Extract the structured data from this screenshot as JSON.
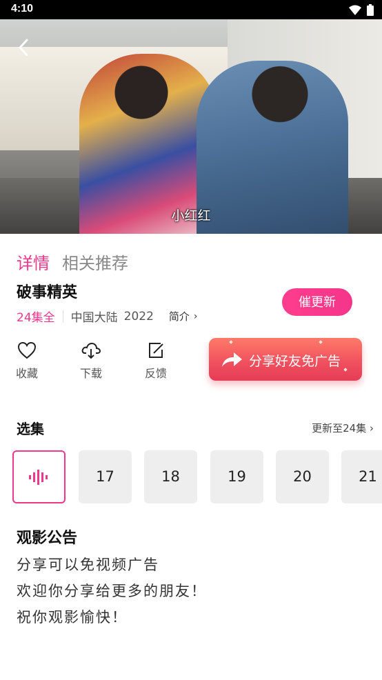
{
  "status_bar": {
    "time": "4:10"
  },
  "video": {
    "subtitle": "小红红"
  },
  "tabs": [
    {
      "label": "详情"
    },
    {
      "label": "相关推荐"
    }
  ],
  "show": {
    "title": "破事精英",
    "episodes_total": "24集全",
    "region": "中国大陆",
    "year": "2022",
    "intro_label": "简介"
  },
  "urge_button": {
    "label": "催更新"
  },
  "actions": [
    {
      "label": "收藏",
      "icon": "heart-icon"
    },
    {
      "label": "下载",
      "icon": "download-icon"
    },
    {
      "label": "反馈",
      "icon": "feedback-icon"
    }
  ],
  "share_banner": {
    "label": "分享好友免广告",
    "icon": "share-arrow-icon"
  },
  "episodes_section": {
    "title": "选集",
    "update_info": "更新至24集",
    "items": [
      "17",
      "18",
      "19",
      "20",
      "21"
    ]
  },
  "notice": {
    "title": "观影公告",
    "lines": [
      "分享可以免视频广告",
      "欢迎你分享给更多的朋友！",
      "祝你观影愉快！"
    ]
  },
  "colors": {
    "accent": "#f0378c",
    "banner": "#ef4f5d"
  }
}
